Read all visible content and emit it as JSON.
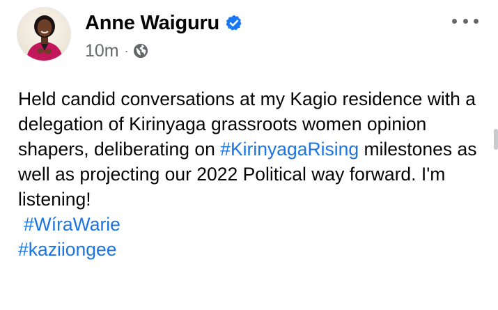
{
  "post": {
    "author": {
      "name": "Anne Waiguru",
      "verified_icon": "verified-badge-icon",
      "avatar_icon": "avatar"
    },
    "meta": {
      "time": "10m",
      "separator": "·",
      "audience_icon": "globe-icon"
    },
    "more_icon": "more-options-icon",
    "body": {
      "text_before_tag": "Held candid conversations at my Kagio residence with a delegation of Kirinyaga grassroots women opinion shapers, deliberating on ",
      "inline_hashtag": "#KirinyagaRising",
      "text_after_tag": " milestones as well as projecting our 2022 Political way forward. I'm listening!",
      "hashtags": [
        "#WíraWarie",
        "#kaziiongee"
      ]
    }
  },
  "colors": {
    "text": "#050505",
    "secondary": "#65676b",
    "link": "#1b74e4",
    "verified": "#1877f2"
  }
}
